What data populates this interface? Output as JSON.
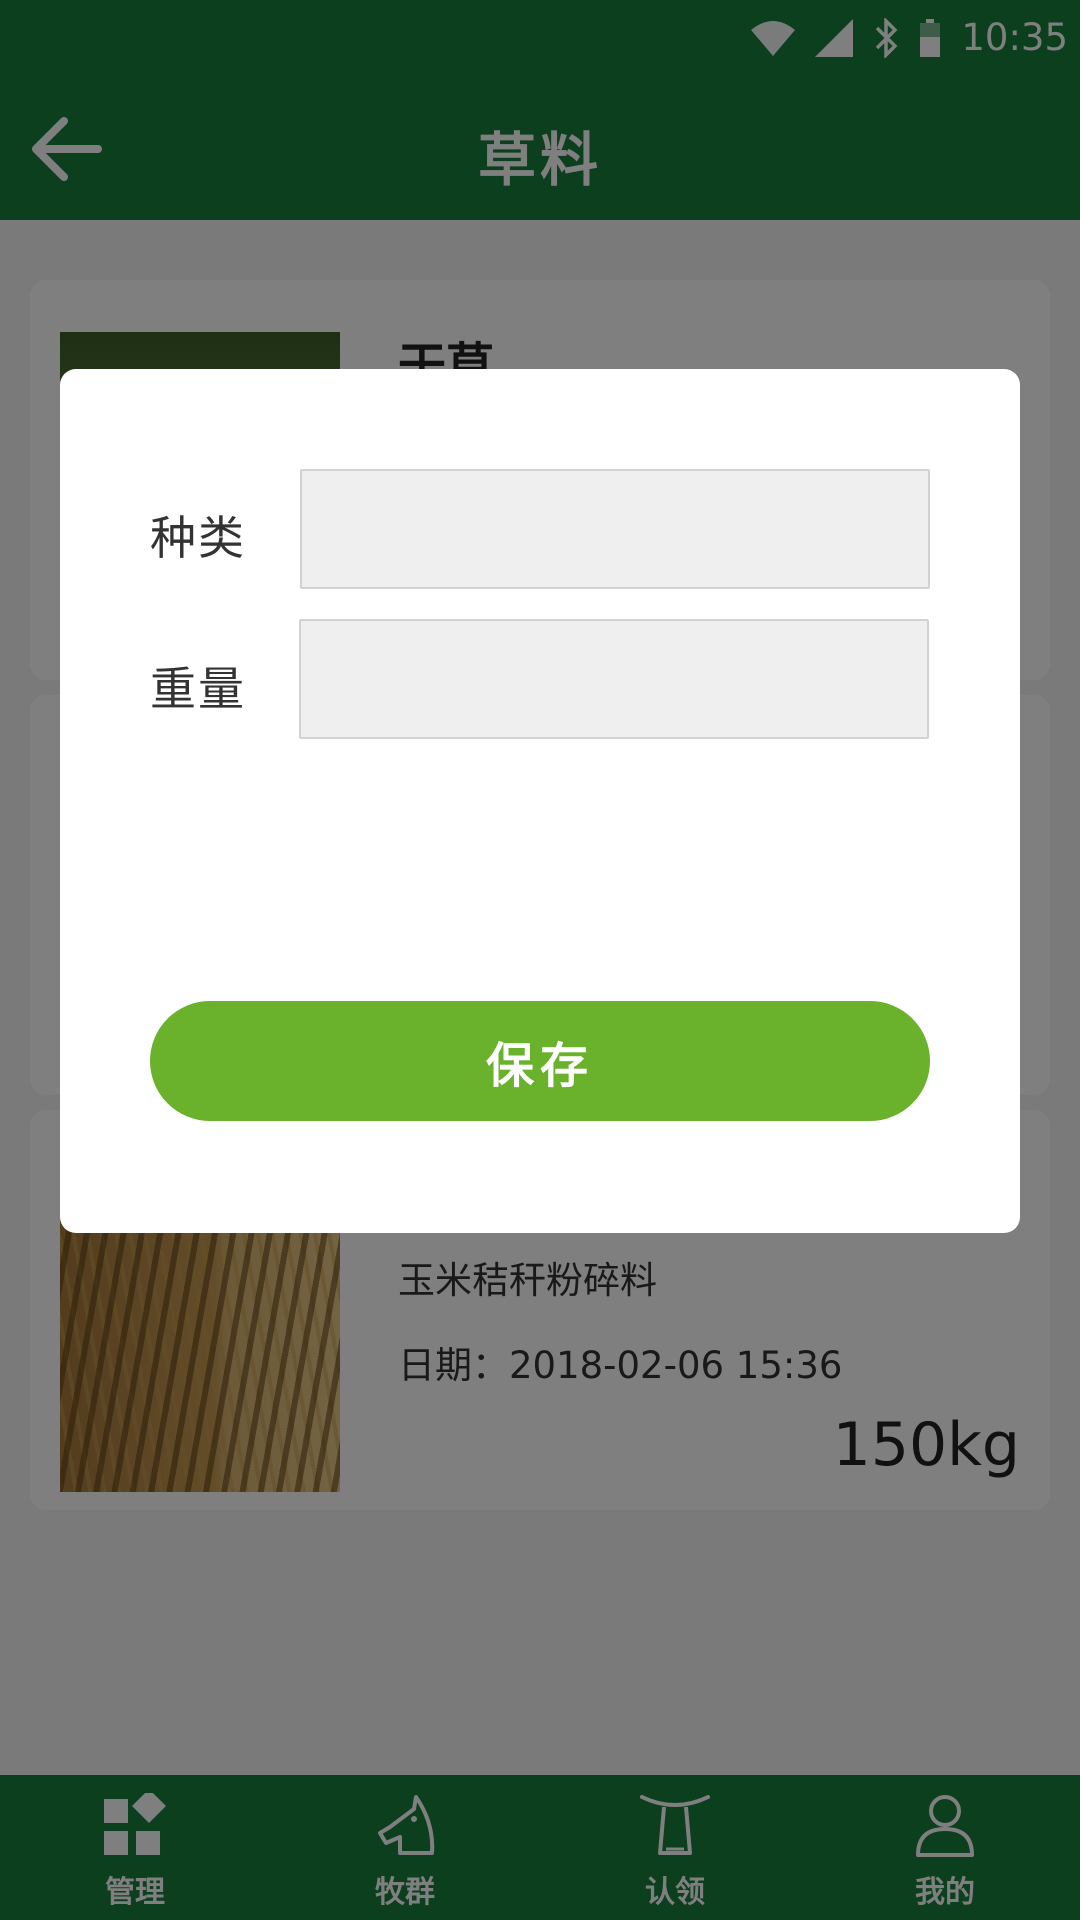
{
  "status_bar": {
    "time": "10:35"
  },
  "app_bar": {
    "title": "草料"
  },
  "cards": [
    {
      "name": "干草",
      "description": "",
      "date": "",
      "weight": ""
    },
    {
      "name": "",
      "description": "",
      "date": "",
      "weight": ""
    },
    {
      "name": "",
      "description": "玉米秸秆粉碎料",
      "date": "日期：2018-02-06   15:36",
      "weight": "150kg"
    }
  ],
  "dialog": {
    "type_label": "种类",
    "type_value": "",
    "weight_label": "重量",
    "weight_value": "",
    "save_label": "保存"
  },
  "bottom_nav": [
    {
      "label": "管理",
      "icon": "grid-icon"
    },
    {
      "label": "牧群",
      "icon": "horse-icon"
    },
    {
      "label": "认领",
      "icon": "yoke-icon"
    },
    {
      "label": "我的",
      "icon": "person-icon"
    }
  ],
  "colors": {
    "primary_green": "#167e3c",
    "button_green": "#6ab12c",
    "scrim": "rgba(0,0,0,0.5)"
  }
}
